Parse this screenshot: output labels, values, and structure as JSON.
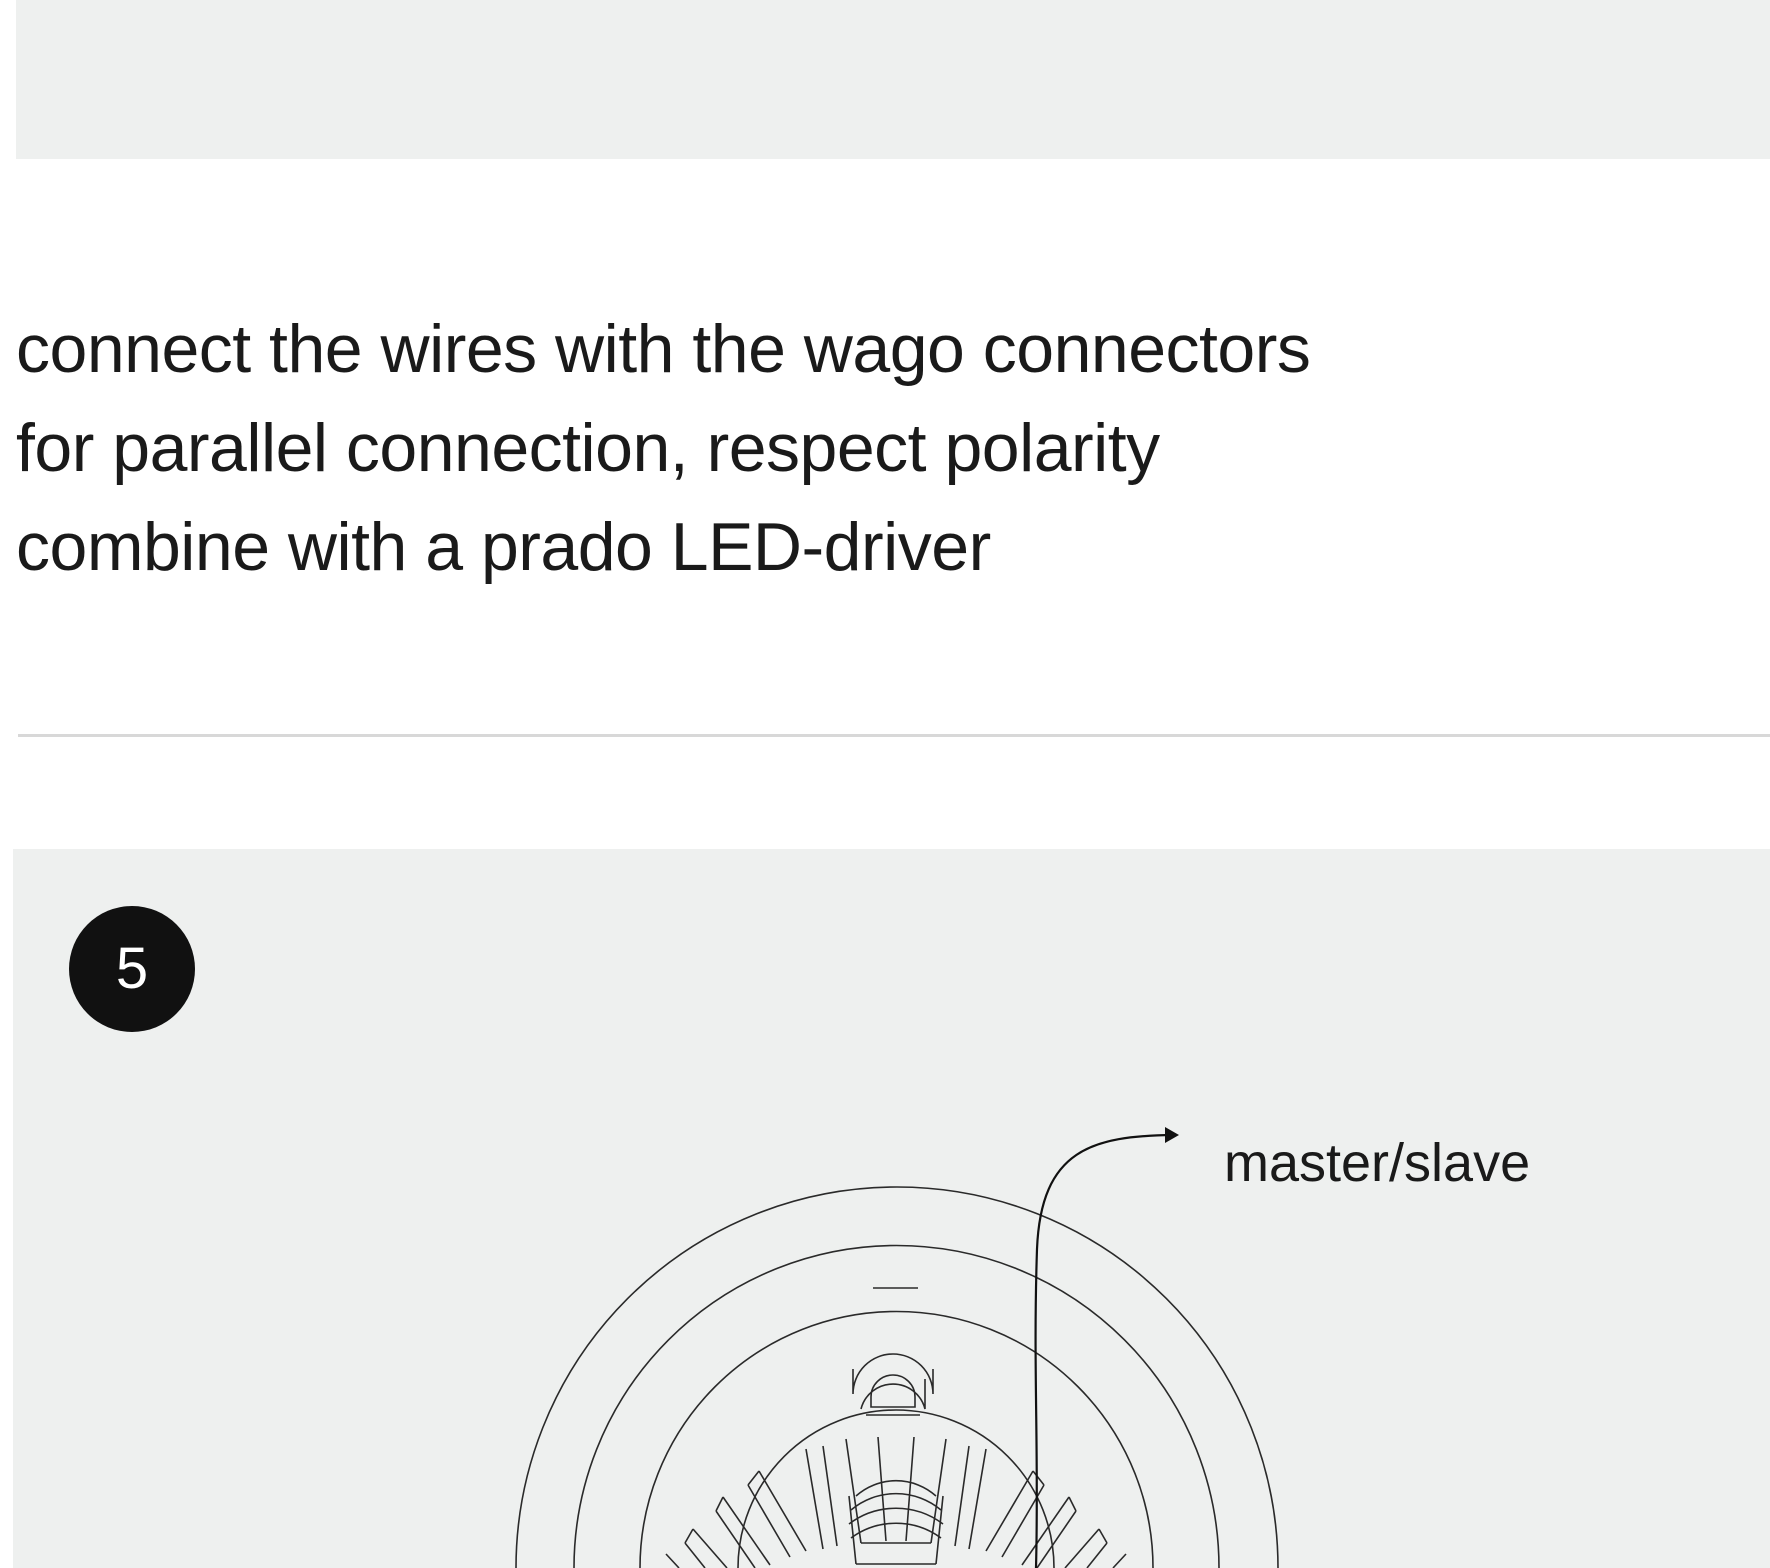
{
  "instructions": {
    "lines": [
      "connect the wires with the wago connectors",
      "for parallel connection, respect polarity",
      "combine with a prado LED-driver"
    ]
  },
  "step": {
    "number": "5",
    "callout_label": "master/slave"
  },
  "colors": {
    "panel_background": "#eef0ef",
    "page_background": "#ffffff",
    "text": "#1a1a1a",
    "badge_background": "#111111",
    "badge_text": "#ffffff",
    "divider": "#d8d8d8"
  }
}
